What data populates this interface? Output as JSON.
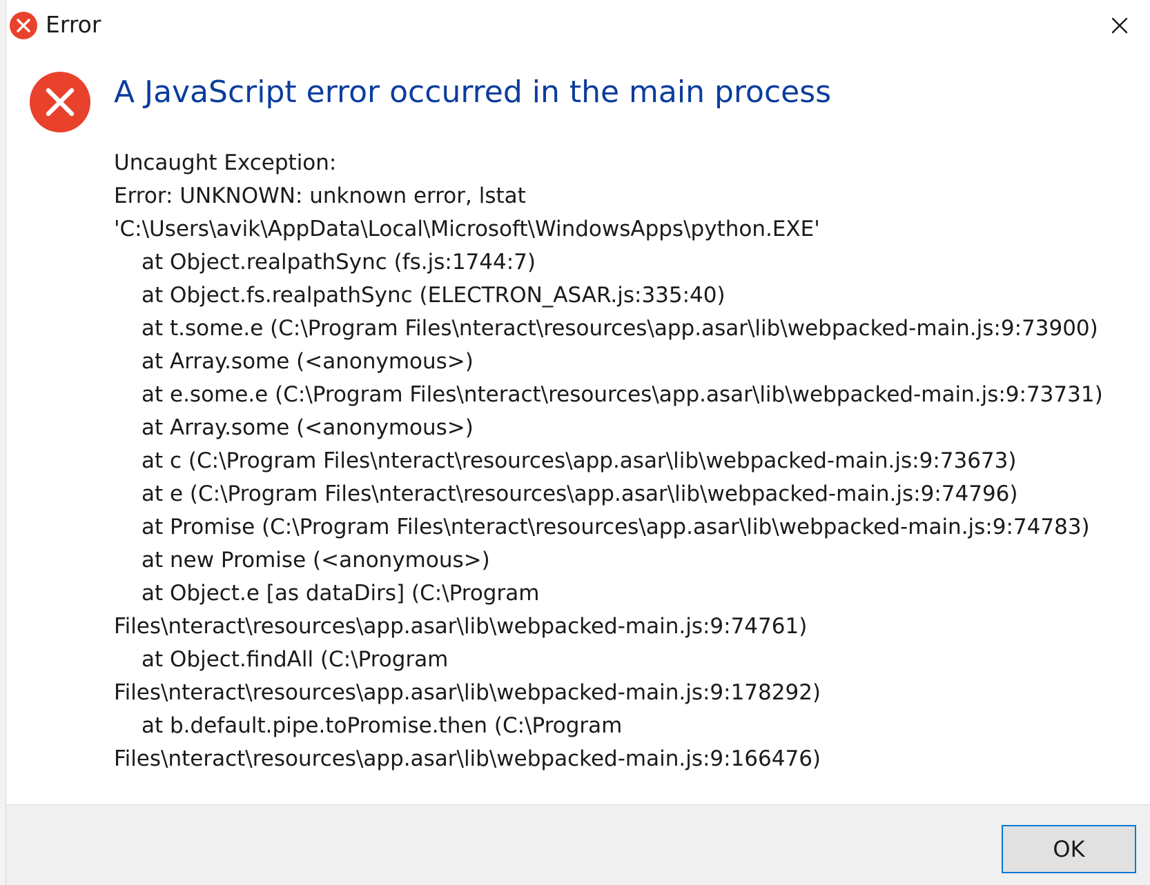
{
  "window": {
    "title": "Error",
    "close_glyph": "×"
  },
  "icons": {
    "title_icon": "error-x-circle-icon",
    "main_icon": "error-x-circle-icon",
    "close_icon": "close-x-icon"
  },
  "dialog": {
    "heading": "A JavaScript error occurred in the main process",
    "lines": [
      {
        "text": "Uncaught Exception:",
        "indent": false
      },
      {
        "text": "Error: UNKNOWN: unknown error, lstat",
        "indent": false
      },
      {
        "text": "'C:\\Users\\avik\\AppData\\Local\\Microsoft\\WindowsApps\\python.EXE'",
        "indent": false
      },
      {
        "text": "at Object.realpathSync (fs.js:1744:7)",
        "indent": true
      },
      {
        "text": "at Object.fs.realpathSync (ELECTRON_ASAR.js:335:40)",
        "indent": true
      },
      {
        "text": "at t.some.e (C:\\Program Files\\nteract\\resources\\app.asar\\lib\\webpacked-main.js:9:73900)",
        "indent": true
      },
      {
        "text": "at Array.some (<anonymous>)",
        "indent": true
      },
      {
        "text": "at e.some.e (C:\\Program Files\\nteract\\resources\\app.asar\\lib\\webpacked-main.js:9:73731)",
        "indent": true
      },
      {
        "text": "at Array.some (<anonymous>)",
        "indent": true
      },
      {
        "text": "at c (C:\\Program Files\\nteract\\resources\\app.asar\\lib\\webpacked-main.js:9:73673)",
        "indent": true
      },
      {
        "text": "at e (C:\\Program Files\\nteract\\resources\\app.asar\\lib\\webpacked-main.js:9:74796)",
        "indent": true
      },
      {
        "text": "at Promise (C:\\Program Files\\nteract\\resources\\app.asar\\lib\\webpacked-main.js:9:74783)",
        "indent": true
      },
      {
        "text": "at new Promise (<anonymous>)",
        "indent": true
      },
      {
        "text": "at Object.e [as dataDirs] (C:\\Program",
        "indent": true
      },
      {
        "text": "Files\\nteract\\resources\\app.asar\\lib\\webpacked-main.js:9:74761)",
        "indent": false
      },
      {
        "text": "at Object.findAll (C:\\Program",
        "indent": true
      },
      {
        "text": "Files\\nteract\\resources\\app.asar\\lib\\webpacked-main.js:9:178292)",
        "indent": false
      },
      {
        "text": "at b.default.pipe.toPromise.then (C:\\Program",
        "indent": true
      },
      {
        "text": "Files\\nteract\\resources\\app.asar\\lib\\webpacked-main.js:9:166476)",
        "indent": false
      }
    ]
  },
  "footer": {
    "ok_label": "OK"
  },
  "colors": {
    "error_red": "#e8412c",
    "heading_blue": "#0a3d9c",
    "focus_blue": "#0078d7"
  }
}
